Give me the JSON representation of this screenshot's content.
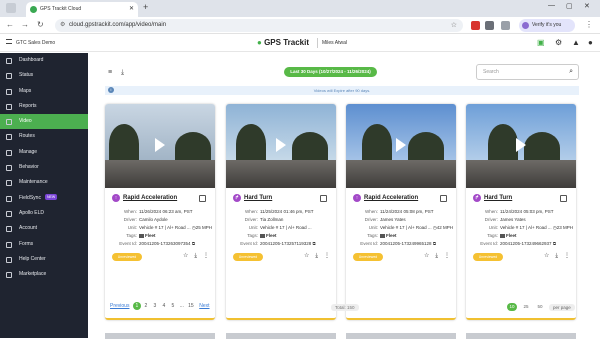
{
  "browser": {
    "tab_title": "GPS Trackit Cloud",
    "url": "cloud.gpstrackit.com/app/video/main",
    "profile_label": "Verify it's you"
  },
  "header": {
    "org_name": "GTC Sales Demo",
    "logo": "GPS Trackit",
    "user_name": "Miles Atwal"
  },
  "sidebar": {
    "items": [
      {
        "label": "Dashboard",
        "icon": "dashboard-icon"
      },
      {
        "label": "Status",
        "icon": "status-icon"
      },
      {
        "label": "Maps",
        "icon": "maps-icon"
      },
      {
        "label": "Reports",
        "icon": "reports-icon"
      },
      {
        "label": "Video",
        "icon": "video-icon",
        "active": true
      },
      {
        "label": "Routes",
        "icon": "routes-icon"
      },
      {
        "label": "Manage",
        "icon": "manage-icon"
      },
      {
        "label": "Behavior",
        "icon": "behavior-icon"
      },
      {
        "label": "Maintenance",
        "icon": "maintenance-icon"
      },
      {
        "label": "FieldSync",
        "icon": "fieldsync-icon",
        "badge": "NEW"
      },
      {
        "label": "Apollo ELD",
        "icon": "eld-icon"
      },
      {
        "label": "Account",
        "icon": "account-icon"
      },
      {
        "label": "Forms",
        "icon": "forms-icon"
      },
      {
        "label": "Help Center",
        "icon": "help-icon"
      },
      {
        "label": "Marketplace",
        "icon": "marketplace-icon"
      }
    ]
  },
  "toolbar": {
    "date_range": "Last 30 Days (10/27/2024 - 11/26/2024)",
    "search_placeholder": "Search",
    "banner": "Videos will Expire after 90 days."
  },
  "cards": [
    {
      "event": "Rapid Acceleration",
      "event_icon": "up-arrow-icon",
      "when": "11/26/2024 06:23 am, PST",
      "driver": "Camilo Aydole",
      "unit": "Vehicle # 17 | Al+ Road ...",
      "speed": "25 MPH",
      "tags": "Fleet",
      "event_id": "20041205-173263097354",
      "status": "Unreviewed"
    },
    {
      "event": "Hard Turn",
      "event_icon": "turn-icon",
      "when": "11/25/2024 01:46 pm, PST",
      "driver": "Tia Zollman",
      "unit": "Vehicle # 17 | Al+ Road ...",
      "speed": "",
      "tags": "Fleet",
      "event_id": "20041205-173257119328",
      "status": "Unreviewed"
    },
    {
      "event": "Rapid Acceleration",
      "event_icon": "up-arrow-icon",
      "when": "11/24/2024 05:08 pm, PST",
      "driver": "James Yates",
      "unit": "Vehicle # 17 | Al+ Road ...",
      "speed": "42 MPH",
      "tags": "Fleet",
      "event_id": "20041205-173249965128",
      "status": "Unreviewed"
    },
    {
      "event": "Hard Turn",
      "event_icon": "turn-icon",
      "when": "11/24/2024 05:03 pm, PST",
      "driver": "James Yates",
      "unit": "Vehicle # 17 | Al+ Road ...",
      "speed": "23 MPH",
      "tags": "Fleet",
      "event_id": "20041205-173249662937",
      "status": "Unreviewed"
    }
  ],
  "labels": {
    "when": "When:",
    "driver": "Driver:",
    "unit": "Unit:",
    "tags": "Tags:",
    "event_id": "Event Id:"
  },
  "pagination": {
    "prev": "Previous",
    "pages": [
      "1",
      "2",
      "3",
      "4",
      "5",
      "...",
      "15"
    ],
    "next": "Next",
    "total": "Total: 150",
    "per_page_options": [
      "10",
      "25",
      "50"
    ],
    "per_page_label": "per page"
  },
  "colors": {
    "accent": "#58b947",
    "sidebar_bg": "#1f2430",
    "status_badge": "#f5c132",
    "event_icon": "#a349c8"
  }
}
